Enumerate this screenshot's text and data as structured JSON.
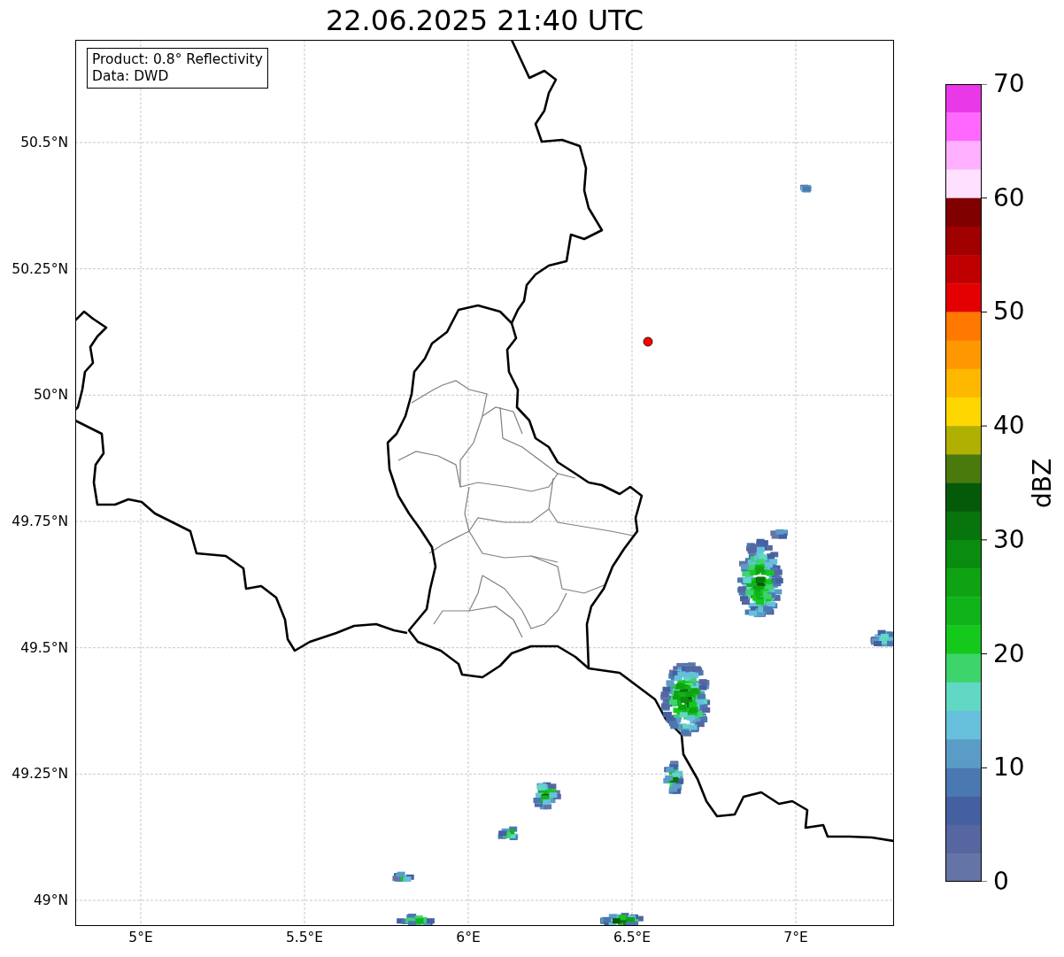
{
  "title": "22.06.2025 21:40 UTC",
  "info_box": [
    "Product: 0.8° Reflectivity",
    "Data: DWD"
  ],
  "map": {
    "xticks": [
      "5°E",
      "5.5°E",
      "6°E",
      "6.5°E",
      "7°E"
    ],
    "yticks": [
      "50.5°N",
      "50.25°N",
      "50°N",
      "49.75°N",
      "49.5°N",
      "49.25°N",
      "49°N"
    ]
  },
  "colorbar": {
    "label": "dBZ",
    "ticks": [
      "70",
      "60",
      "50",
      "40",
      "30",
      "20",
      "10",
      "0"
    ],
    "segments": [
      {
        "color": "#e838e8"
      },
      {
        "color": "#ff68ff"
      },
      {
        "color": "#ffb0ff"
      },
      {
        "color": "#ffe0ff"
      },
      {
        "color": "#800000"
      },
      {
        "color": "#a00000"
      },
      {
        "color": "#c00000"
      },
      {
        "color": "#e40000"
      },
      {
        "color": "#ff7800"
      },
      {
        "color": "#ff9800"
      },
      {
        "color": "#ffb800"
      },
      {
        "color": "#ffd700"
      },
      {
        "color": "#b0b000"
      },
      {
        "color": "#4a7a0c"
      },
      {
        "color": "#055a0a"
      },
      {
        "color": "#08740c"
      },
      {
        "color": "#0a8c10"
      },
      {
        "color": "#0ea312"
      },
      {
        "color": "#10b41a"
      },
      {
        "color": "#14c81c"
      },
      {
        "color": "#3dd46c"
      },
      {
        "color": "#60d8c4"
      },
      {
        "color": "#66c0dc"
      },
      {
        "color": "#5a9cc6"
      },
      {
        "color": "#4a78b0"
      },
      {
        "color": "#4560a0"
      },
      {
        "color": "#5566a0"
      },
      {
        "color": "#6574a6"
      }
    ]
  }
}
